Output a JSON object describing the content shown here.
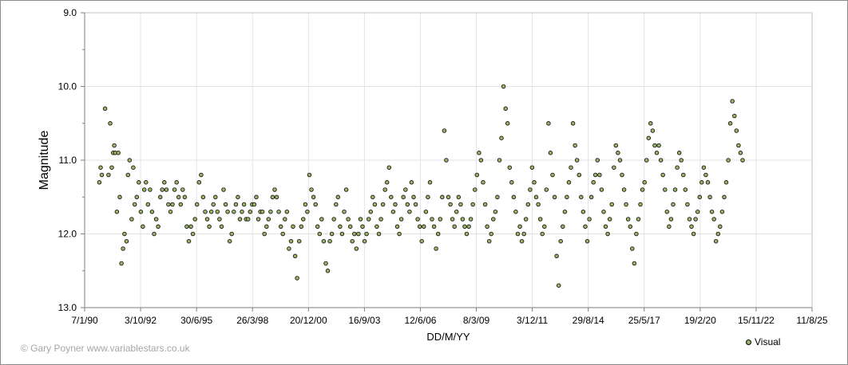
{
  "chart_data": {
    "type": "scatter",
    "title": "",
    "xlabel": "DD/M/YY",
    "ylabel": "Magnitude",
    "x_ticks": [
      "7/1/90",
      "3/10/92",
      "30/6/95",
      "26/3/98",
      "20/12/00",
      "16/9/03",
      "12/6/06",
      "8/3/09",
      "3/12/11",
      "29/8/14",
      "25/5/17",
      "19/2/20",
      "15/11/22",
      "11/8/25"
    ],
    "y_ticks": [
      "9.0",
      "10.0",
      "11.0",
      "12.0",
      "13.0"
    ],
    "xlim": [
      "7/1/90",
      "11/8/25"
    ],
    "ylim": [
      13.0,
      9.0
    ],
    "y_inverted": true,
    "grid": true,
    "legend_position": "bottom-right",
    "series": [
      {
        "name": "Visual",
        "color": "#9bb565",
        "x_year": [
          1990.72,
          1990.78,
          1990.84,
          1991.0,
          1991.17,
          1991.25,
          1991.33,
          1991.4,
          1991.45,
          1991.5,
          1991.58,
          1991.65,
          1991.72,
          1991.8,
          1991.88,
          1991.95,
          1992.05,
          1992.12,
          1992.2,
          1992.3,
          1992.38,
          1992.45,
          1992.55,
          1992.65,
          1992.75,
          1992.85,
          1992.92,
          1993.0,
          1993.1,
          1993.2,
          1993.3,
          1993.4,
          1993.5,
          1993.6,
          1993.7,
          1993.8,
          1993.9,
          1994.0,
          1994.1,
          1994.2,
          1994.3,
          1994.4,
          1994.5,
          1994.6,
          1994.7,
          1994.8,
          1994.9,
          1995.0,
          1995.1,
          1995.2,
          1995.3,
          1995.4,
          1995.5,
          1995.6,
          1995.7,
          1995.8,
          1995.9,
          1996.0,
          1996.1,
          1996.2,
          1996.3,
          1996.4,
          1996.5,
          1996.6,
          1996.7,
          1996.8,
          1996.9,
          1997.0,
          1997.1,
          1997.2,
          1997.3,
          1997.4,
          1997.5,
          1997.6,
          1997.7,
          1997.8,
          1997.9,
          1998.0,
          1998.1,
          1998.2,
          1998.3,
          1998.4,
          1998.5,
          1998.6,
          1998.7,
          1998.8,
          1998.9,
          1999.0,
          1999.1,
          1999.2,
          1999.3,
          1999.4,
          1999.5,
          1999.6,
          1999.7,
          1999.8,
          1999.9,
          2000.0,
          2000.1,
          2000.2,
          2000.3,
          2000.4,
          2000.5,
          2000.6,
          2000.7,
          2000.8,
          2000.9,
          2001.0,
          2001.1,
          2001.2,
          2001.3,
          2001.4,
          2001.5,
          2001.6,
          2001.7,
          2001.8,
          2001.9,
          2002.0,
          2002.1,
          2002.2,
          2002.3,
          2002.4,
          2002.5,
          2002.6,
          2002.7,
          2002.8,
          2002.9,
          2003.0,
          2003.1,
          2003.2,
          2003.3,
          2003.4,
          2003.5,
          2003.6,
          2003.7,
          2003.8,
          2003.9,
          2004.0,
          2004.1,
          2004.2,
          2004.3,
          2004.4,
          2004.5,
          2004.6,
          2004.7,
          2004.8,
          2004.9,
          2005.0,
          2005.1,
          2005.2,
          2005.3,
          2005.4,
          2005.5,
          2005.6,
          2005.7,
          2005.8,
          2005.9,
          2006.0,
          2006.1,
          2006.2,
          2006.3,
          2006.4,
          2006.5,
          2006.6,
          2006.7,
          2006.8,
          2006.9,
          2007.0,
          2007.1,
          2007.2,
          2007.3,
          2007.4,
          2007.5,
          2007.6,
          2007.7,
          2007.8,
          2007.9,
          2008.0,
          2008.1,
          2008.2,
          2008.3,
          2008.4,
          2008.5,
          2008.6,
          2008.7,
          2008.8,
          2008.9,
          2009.0,
          2009.1,
          2009.2,
          2009.3,
          2009.4,
          2009.5,
          2009.6,
          2009.7,
          2009.8,
          2009.9,
          2010.0,
          2010.1,
          2010.2,
          2010.3,
          2010.4,
          2010.5,
          2010.6,
          2010.7,
          2010.8,
          2010.9,
          2011.0,
          2011.1,
          2011.2,
          2011.3,
          2011.4,
          2011.5,
          2011.6,
          2011.7,
          2011.8,
          2011.9,
          2012.0,
          2012.1,
          2012.2,
          2012.3,
          2012.4,
          2012.5,
          2012.6,
          2012.7,
          2012.8,
          2012.9,
          2013.0,
          2013.1,
          2013.2,
          2013.3,
          2013.4,
          2013.5,
          2013.6,
          2013.7,
          2013.8,
          2013.9,
          2014.0,
          2014.1,
          2014.2,
          2014.3,
          2014.4,
          2014.5,
          2014.6,
          2014.7,
          2014.8,
          2014.9,
          2015.0,
          2015.1,
          2015.2,
          2015.3,
          2015.4,
          2015.5,
          2015.6,
          2015.7,
          2015.8,
          2015.9,
          2016.0,
          2016.1,
          2016.2,
          2016.3,
          2016.4,
          2016.5,
          2016.6,
          2016.7,
          2016.8,
          2016.9,
          2017.0,
          2017.1,
          2017.2,
          2017.3,
          2017.4,
          2017.5,
          2017.6,
          2017.7,
          2017.8,
          2017.9,
          2018.0,
          2018.1,
          2018.2,
          2018.3,
          2018.4,
          2018.5,
          2018.6,
          2018.7,
          2018.8,
          2018.9,
          2019.0,
          2019.1,
          2019.2,
          2019.3,
          2019.4,
          2019.5,
          2019.6,
          2019.7,
          2019.8,
          2019.9,
          2020.0,
          2020.1,
          2020.2,
          2020.3,
          2020.4,
          2020.5,
          2020.6,
          2020.7,
          2020.8,
          2020.9,
          2021.0,
          2021.1,
          2021.2,
          2021.3,
          2021.4,
          2021.5,
          2021.6,
          2021.7,
          2021.8,
          2021.9,
          2022.0,
          2022.1,
          2022.2,
          2022.3,
          2022.4,
          2022.5,
          2022.6,
          2022.7,
          2022.8,
          2022.9,
          2023.0,
          2023.1,
          2023.2,
          2023.3
        ],
        "magnitudes": [
          11.3,
          11.1,
          11.2,
          10.3,
          11.2,
          10.5,
          11.1,
          10.9,
          10.8,
          10.9,
          11.7,
          10.9,
          11.5,
          12.4,
          12.2,
          12.0,
          12.1,
          11.2,
          11.0,
          11.8,
          11.1,
          11.6,
          11.5,
          11.3,
          11.7,
          11.9,
          11.4,
          11.3,
          11.6,
          11.4,
          11.7,
          12.0,
          11.8,
          11.9,
          11.5,
          11.4,
          11.3,
          11.4,
          11.6,
          11.7,
          11.6,
          11.4,
          11.3,
          11.5,
          11.6,
          11.4,
          11.5,
          11.9,
          12.1,
          11.9,
          12.0,
          11.8,
          11.6,
          11.3,
          11.2,
          11.5,
          11.7,
          11.8,
          11.9,
          11.7,
          11.6,
          11.5,
          11.7,
          11.8,
          11.9,
          11.4,
          11.6,
          11.7,
          12.1,
          12.0,
          11.7,
          11.6,
          11.5,
          11.8,
          11.7,
          11.6,
          11.8,
          11.8,
          11.7,
          11.6,
          11.6,
          11.5,
          11.8,
          11.7,
          11.7,
          12.0,
          11.9,
          11.8,
          11.7,
          11.5,
          11.4,
          11.5,
          11.7,
          11.9,
          12.0,
          11.8,
          11.7,
          12.2,
          12.1,
          11.9,
          12.3,
          12.6,
          12.1,
          11.9,
          11.8,
          11.6,
          11.7,
          11.2,
          11.4,
          11.5,
          11.6,
          11.9,
          12.0,
          11.8,
          12.1,
          12.4,
          12.5,
          12.1,
          12.0,
          11.8,
          11.6,
          11.5,
          11.9,
          12.0,
          11.7,
          11.4,
          11.8,
          11.9,
          12.1,
          12.0,
          12.2,
          12.0,
          11.8,
          11.9,
          12.1,
          12.0,
          11.8,
          11.7,
          11.5,
          11.6,
          11.9,
          12.0,
          11.8,
          11.6,
          11.4,
          11.3,
          11.1,
          11.5,
          11.7,
          11.6,
          11.9,
          12.0,
          11.8,
          11.5,
          11.4,
          11.6,
          11.7,
          11.3,
          11.5,
          11.6,
          11.8,
          11.9,
          12.1,
          11.9,
          11.7,
          11.5,
          11.3,
          11.8,
          11.9,
          12.2,
          12.0,
          11.8,
          11.5,
          10.6,
          11.0,
          11.5,
          11.6,
          11.8,
          11.9,
          11.7,
          11.5,
          11.6,
          11.8,
          11.9,
          12.0,
          11.9,
          11.8,
          11.6,
          11.4,
          11.2,
          10.9,
          11.0,
          11.3,
          11.6,
          11.9,
          12.1,
          12.0,
          11.8,
          11.7,
          11.5,
          11.0,
          10.7,
          10.0,
          10.3,
          10.5,
          11.1,
          11.3,
          11.5,
          11.7,
          12.0,
          11.9,
          12.1,
          12.0,
          11.8,
          11.6,
          11.4,
          11.1,
          11.3,
          11.5,
          11.6,
          11.8,
          12.0,
          11.9,
          11.4,
          10.5,
          10.9,
          11.2,
          11.5,
          12.3,
          12.7,
          12.1,
          11.9,
          11.7,
          11.5,
          11.3,
          11.1,
          10.5,
          10.8,
          11.0,
          11.2,
          11.5,
          11.7,
          11.9,
          12.1,
          11.8,
          11.5,
          11.3,
          11.2,
          11.0,
          11.2,
          11.4,
          11.7,
          11.9,
          12.0,
          11.8,
          11.6,
          11.1,
          10.8,
          10.9,
          11.0,
          11.2,
          11.4,
          11.6,
          11.8,
          11.9,
          12.2,
          12.4,
          12.0,
          11.8,
          11.6,
          11.4,
          11.3,
          11.0,
          10.7,
          10.5,
          10.6,
          10.8,
          10.9,
          10.8,
          11.0,
          11.2,
          11.4,
          11.7,
          11.9,
          11.8,
          11.6,
          11.4,
          11.1,
          10.9,
          11.0,
          11.2,
          11.4,
          11.6,
          11.8,
          11.9,
          12.0,
          11.8,
          11.7,
          11.5,
          11.3,
          11.1,
          11.2,
          11.3,
          11.5,
          11.7,
          11.8,
          12.1,
          12.0,
          11.9,
          11.7,
          11.5,
          11.3,
          11.0,
          10.5,
          10.2,
          10.4,
          10.6,
          10.8,
          10.9,
          11.0
        ]
      }
    ]
  },
  "footer": {
    "credit": "© Gary Poyner www.variablestars.co.uk",
    "legend_label": "Visual"
  }
}
